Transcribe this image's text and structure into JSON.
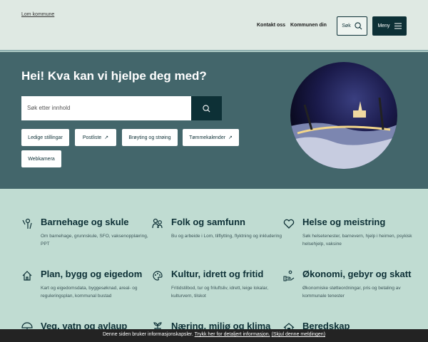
{
  "header": {
    "logo_alt": "Lom kommune",
    "nav": [
      "Kontakt oss",
      "Kommunen din"
    ],
    "search_label": "Søk",
    "menu_label": "Meny"
  },
  "hero": {
    "title": "Hei! Kva kan vi hjelpe deg med?",
    "search_placeholder": "Søk etter innhold",
    "chips": [
      {
        "label": "Ledige stillingar"
      },
      {
        "label": "Postliste",
        "external": true
      },
      {
        "label": "Brøyting og strøing"
      },
      {
        "label": "Tømmekalender",
        "external": true
      },
      {
        "label": "Webkamera"
      }
    ]
  },
  "categories": [
    {
      "icon": "child-icon",
      "title": "Barnehage og skule",
      "desc": "Om barnehage, grunnskule, SFO, vaksenopplæring, PPT"
    },
    {
      "icon": "people-icon",
      "title": "Folk og samfunn",
      "desc": "Bu og arbeide i Lom, tilflytting, flyktning og inkludering"
    },
    {
      "icon": "heart-icon",
      "title": "Helse og meistring",
      "desc": "Søk helsetenester, barnevern, hjelp i heimen, psykisk helsehjelp, vaksine"
    },
    {
      "icon": "house-icon",
      "title": "Plan, bygg og eigedom",
      "desc": "Kart og eigedomsdata, byggesøknad, areal- og reguleringsplan, kommunal bustad"
    },
    {
      "icon": "palette-icon",
      "title": "Kultur, idrett og fritid",
      "desc": "Fritidstilbod, tur og friluftsliv, idrett, leige lokalar, kulturvern, tilskot"
    },
    {
      "icon": "hand-coins-icon",
      "title": "Økonomi, gebyr og skatt",
      "desc": "Økonomiske støtteordningar, pris og betaling av kommunale tenester"
    },
    {
      "icon": "umbrella-icon",
      "title": "Veg, vatn og avlaup",
      "desc": ""
    },
    {
      "icon": "plant-icon",
      "title": "Næring, miljø og klima",
      "desc": ""
    },
    {
      "icon": "shelter-icon",
      "title": "Beredskap",
      "desc": ""
    }
  ],
  "cookie": {
    "text": "Denne siden bruker informasjonskapsler.",
    "link": "Trykk her for detaljert informasjon.",
    "dismiss": "(Skjul denne meldingen)"
  }
}
